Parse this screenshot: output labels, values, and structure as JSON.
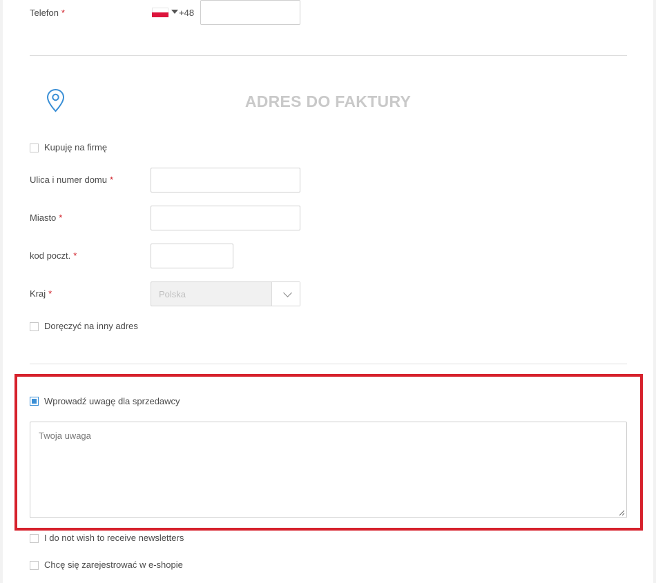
{
  "phone": {
    "label": "Telefon",
    "required_mark": "*",
    "country_flag": "poland-flag-icon",
    "dial_code": "+48",
    "value": ""
  },
  "billing": {
    "title": "ADRES DO FAKTURY",
    "icon": "map-pin-icon",
    "company_checkbox": {
      "label": "Kupuję na firmę",
      "checked": false
    },
    "fields": {
      "street": {
        "label": "Ulica i numer domu",
        "required_mark": "*",
        "value": ""
      },
      "city": {
        "label": "Miasto",
        "required_mark": "*",
        "value": ""
      },
      "postal": {
        "label": "kod poczt.",
        "required_mark": "*",
        "value": ""
      },
      "country": {
        "label": "Kraj",
        "required_mark": "*",
        "value": "Polska"
      }
    },
    "other_address_checkbox": {
      "label": "Doręczyć na inny adres",
      "checked": false
    }
  },
  "note": {
    "checkbox_label": "Wprowadź uwagę dla sprzedawcy",
    "checked": true,
    "placeholder": "Twoja uwaga"
  },
  "newsletter": {
    "label": "I do not wish to receive newsletters",
    "checked": false
  },
  "register": {
    "label": "Chcę się zarejestrować w e-shopie",
    "checked": false
  },
  "colors": {
    "highlight_border": "#d6212c",
    "accent": "#3a8fd6",
    "required": "#d0212a",
    "title_gray": "#c9c9c9"
  }
}
